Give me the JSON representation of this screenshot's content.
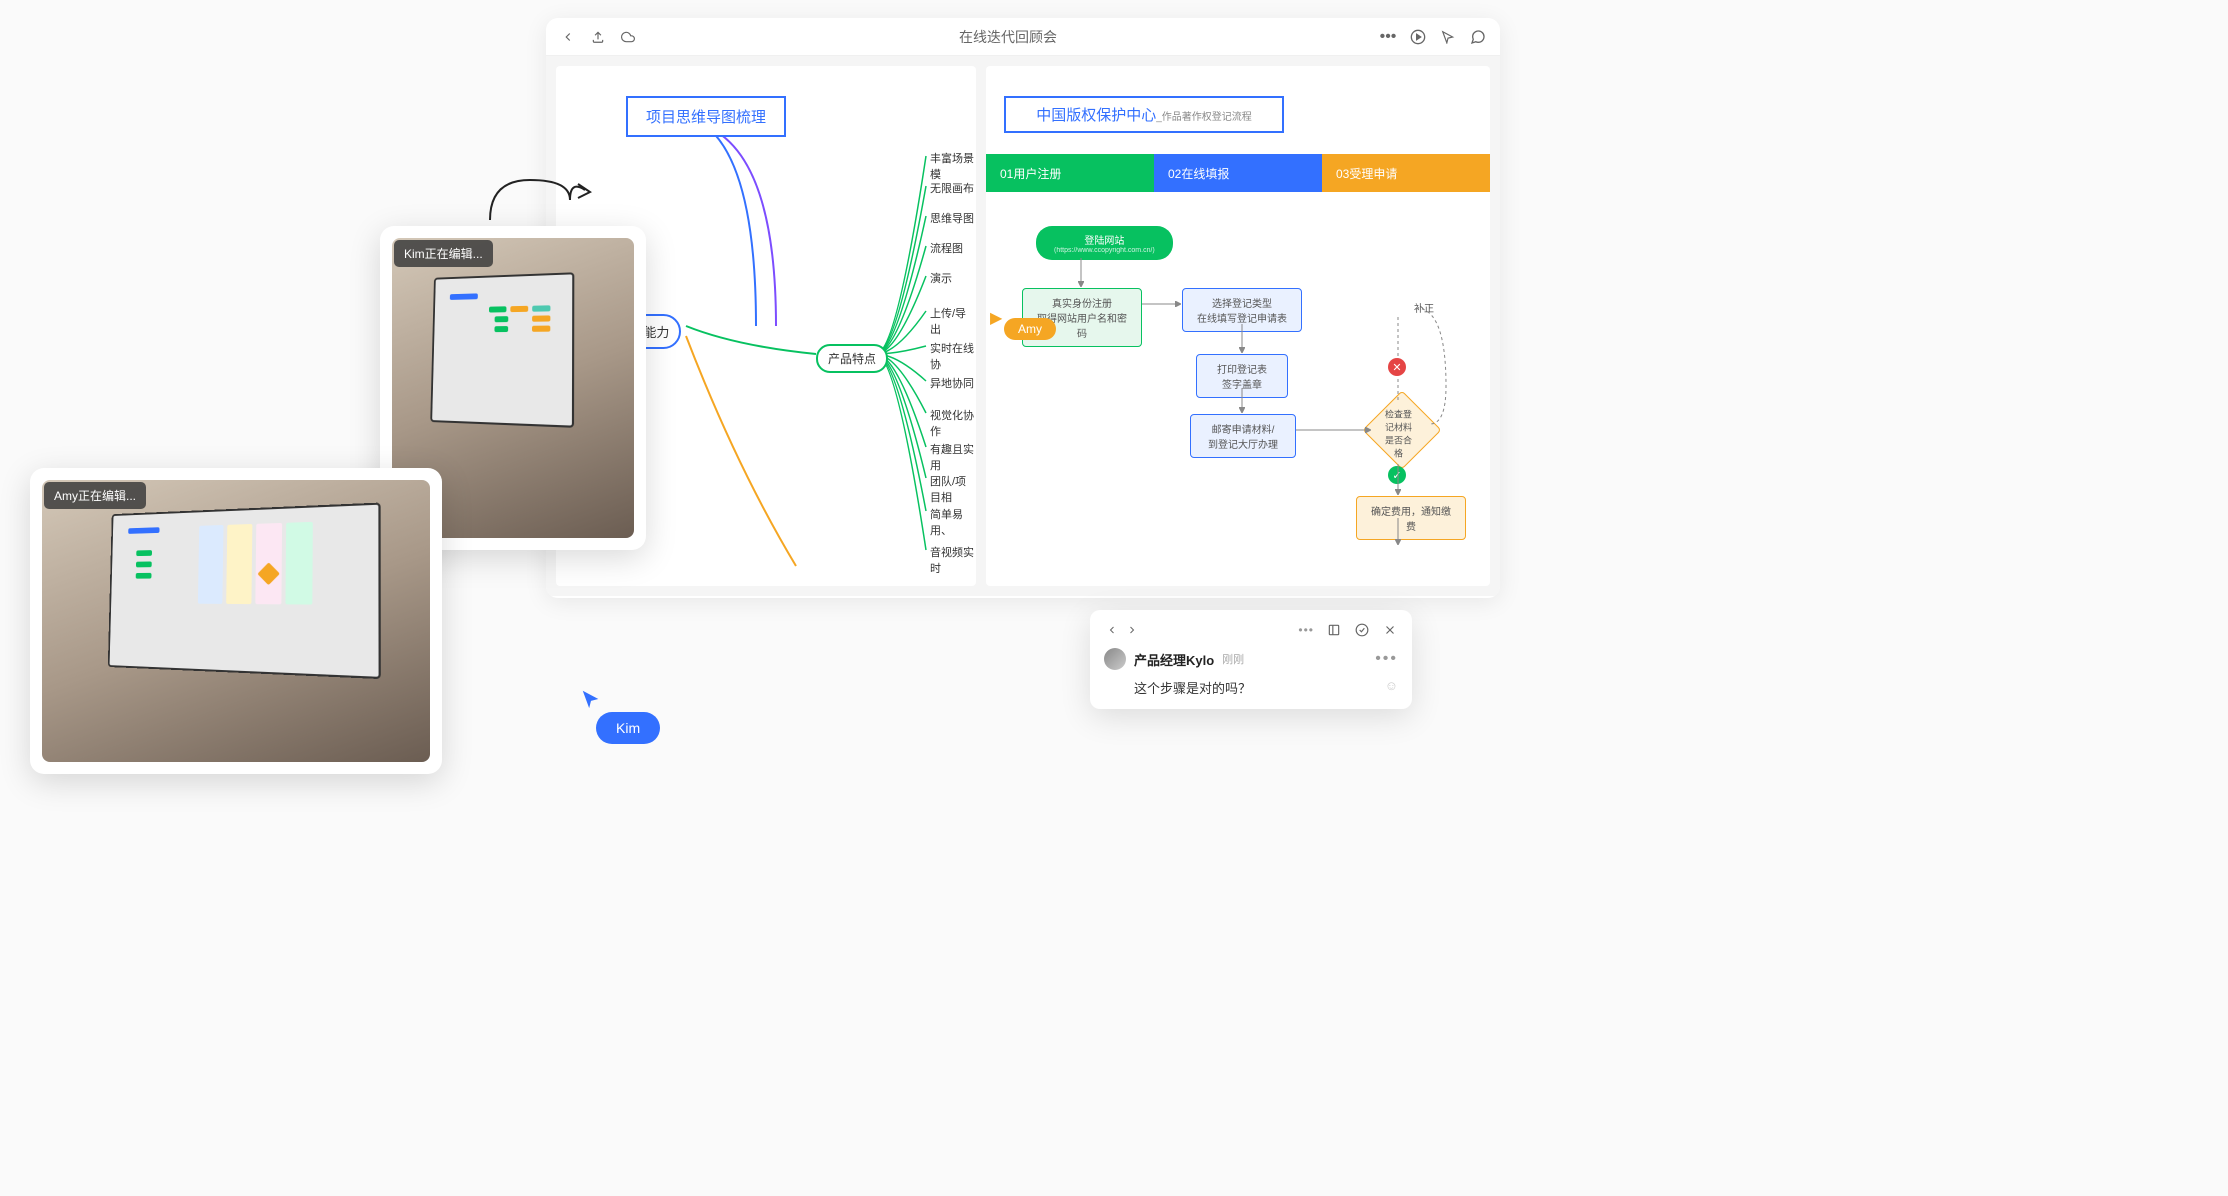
{
  "toolbar": {
    "title": "在线迭代回顾会"
  },
  "mindmap": {
    "title": "项目思维导图梳理",
    "root": "ix产品能力",
    "hub": "产品特点",
    "leaves": [
      "丰富场景模",
      "无限画布",
      "思维导图",
      "流程图",
      "演示",
      "上传/导出",
      "实时在线协",
      "异地协同",
      "视觉化协作",
      "有趣且实用",
      "团队/项目相",
      "简单易用、",
      "音视频实时"
    ]
  },
  "flowchart": {
    "title_main": "中国版权保护中心",
    "title_sub": "_作品著作权登记流程",
    "cols": [
      "01用户注册",
      "02在线填报",
      "03受理申请"
    ],
    "n_login": "登陆网站",
    "n_login_sub": "(https://www.ccopyright.com.cn/)",
    "n_register": "真实身份注册\n取得网站用户名和密码",
    "n_select": "选择登记类型\n在线填写登记申请表",
    "n_print": "打印登记表\n签字盖章",
    "n_mail": "邮寄申请材料/\n到登记大厅办理",
    "n_correct": "补正",
    "n_check": "检查登记材料\n是否合格",
    "n_fee": "确定费用，通知缴费"
  },
  "cursors": {
    "amy": "Amy",
    "kim": "Kim"
  },
  "photos": {
    "kim_label": "Kim正在编辑...",
    "amy_label": "Amy正在编辑..."
  },
  "comment": {
    "name": "产品经理Kylo",
    "time": "刚刚",
    "body": "这个步骤是对的吗？"
  }
}
